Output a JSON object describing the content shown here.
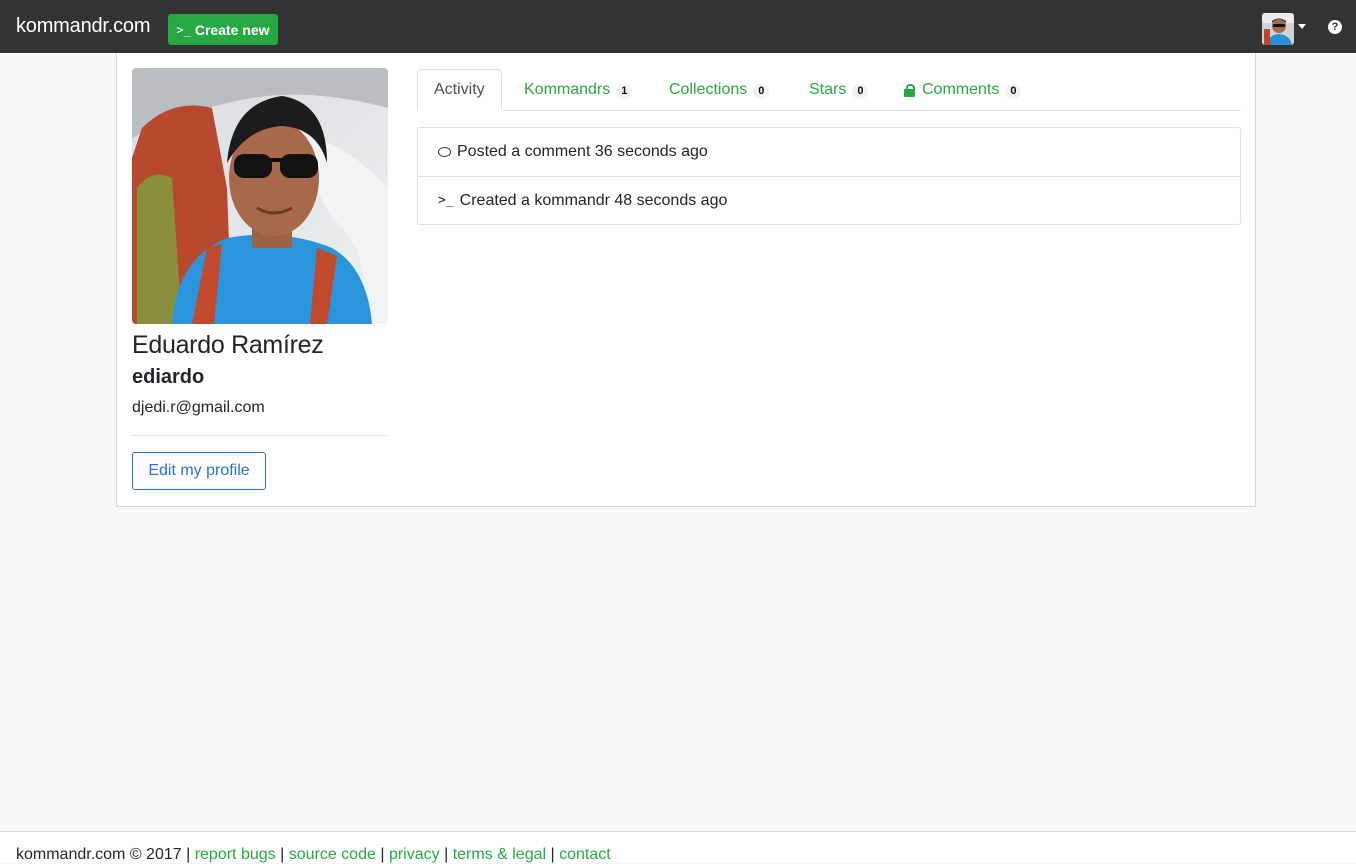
{
  "nav": {
    "brand": "kommandr.com",
    "create_button": {
      "icon": ">_",
      "label": "Create new"
    },
    "avatar_icon": "user-avatar",
    "help_icon": "question-circle-icon"
  },
  "profile": {
    "full_name": "Eduardo Ramírez",
    "username": "ediardo",
    "email": "djedi.r@gmail.com",
    "edit_button": "Edit my profile"
  },
  "tabs": [
    {
      "label": "Activity",
      "active": true
    },
    {
      "label": "Kommandrs",
      "count": "1"
    },
    {
      "label": "Collections",
      "count": "0"
    },
    {
      "label": "Stars",
      "count": "0"
    },
    {
      "label": "Comments",
      "count": "0",
      "icon": "lock-icon"
    }
  ],
  "activity": [
    {
      "icon": "comment-icon",
      "text": "Posted a comment 36 seconds ago"
    },
    {
      "icon": "terminal-icon",
      "text": "Created a kommandr 48 seconds ago"
    }
  ],
  "footer": {
    "copyright": "kommandr.com © 2017",
    "separator": "|",
    "links": [
      "report bugs",
      "source code",
      "privacy",
      "terms & legal",
      "contact"
    ]
  },
  "colors": {
    "navbar": "#333333",
    "accent_green": "#28a745",
    "edit_blue": "#2a72d4"
  }
}
